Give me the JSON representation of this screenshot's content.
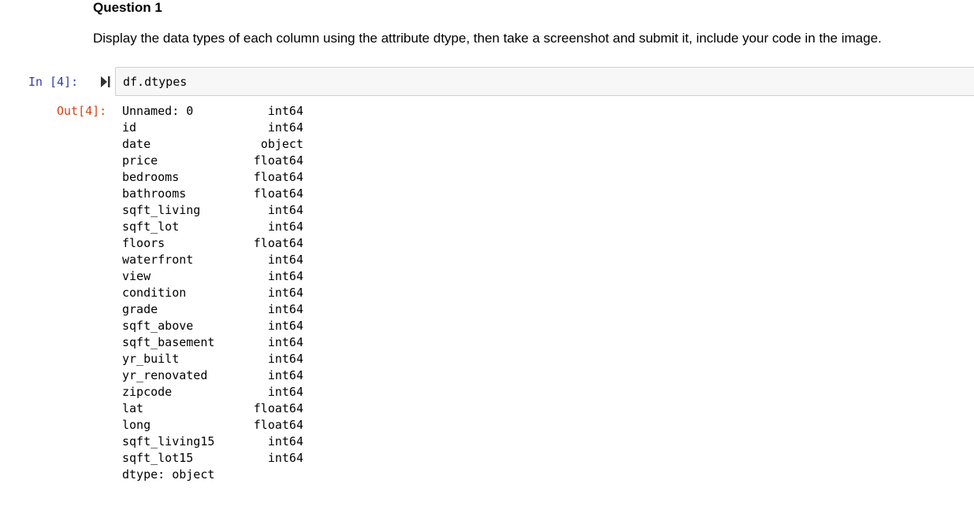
{
  "question": {
    "heading": "Question 1",
    "text": "Display the data types of each column using the attribute dtype, then take a screenshot and submit it, include your code in the image."
  },
  "code_cell": {
    "prompt": "In [4]:",
    "code": "df.dtypes"
  },
  "output_cell": {
    "prompt": "Out[4]:",
    "rows": [
      {
        "name": "Unnamed: 0",
        "dtype": "int64"
      },
      {
        "name": "id",
        "dtype": "int64"
      },
      {
        "name": "date",
        "dtype": "object"
      },
      {
        "name": "price",
        "dtype": "float64"
      },
      {
        "name": "bedrooms",
        "dtype": "float64"
      },
      {
        "name": "bathrooms",
        "dtype": "float64"
      },
      {
        "name": "sqft_living",
        "dtype": "int64"
      },
      {
        "name": "sqft_lot",
        "dtype": "int64"
      },
      {
        "name": "floors",
        "dtype": "float64"
      },
      {
        "name": "waterfront",
        "dtype": "int64"
      },
      {
        "name": "view",
        "dtype": "int64"
      },
      {
        "name": "condition",
        "dtype": "int64"
      },
      {
        "name": "grade",
        "dtype": "int64"
      },
      {
        "name": "sqft_above",
        "dtype": "int64"
      },
      {
        "name": "sqft_basement",
        "dtype": "int64"
      },
      {
        "name": "yr_built",
        "dtype": "int64"
      },
      {
        "name": "yr_renovated",
        "dtype": "int64"
      },
      {
        "name": "zipcode",
        "dtype": "int64"
      },
      {
        "name": "lat",
        "dtype": "float64"
      },
      {
        "name": "long",
        "dtype": "float64"
      },
      {
        "name": "sqft_living15",
        "dtype": "int64"
      },
      {
        "name": "sqft_lot15",
        "dtype": "int64"
      }
    ],
    "footer": "dtype: object"
  },
  "colors": {
    "in_prompt": "#303f9f",
    "out_prompt": "#d84315",
    "cell_background": "#f7f7f7",
    "cell_border": "#cfcfcf"
  },
  "icons": {
    "run": "run-cell-icon"
  }
}
